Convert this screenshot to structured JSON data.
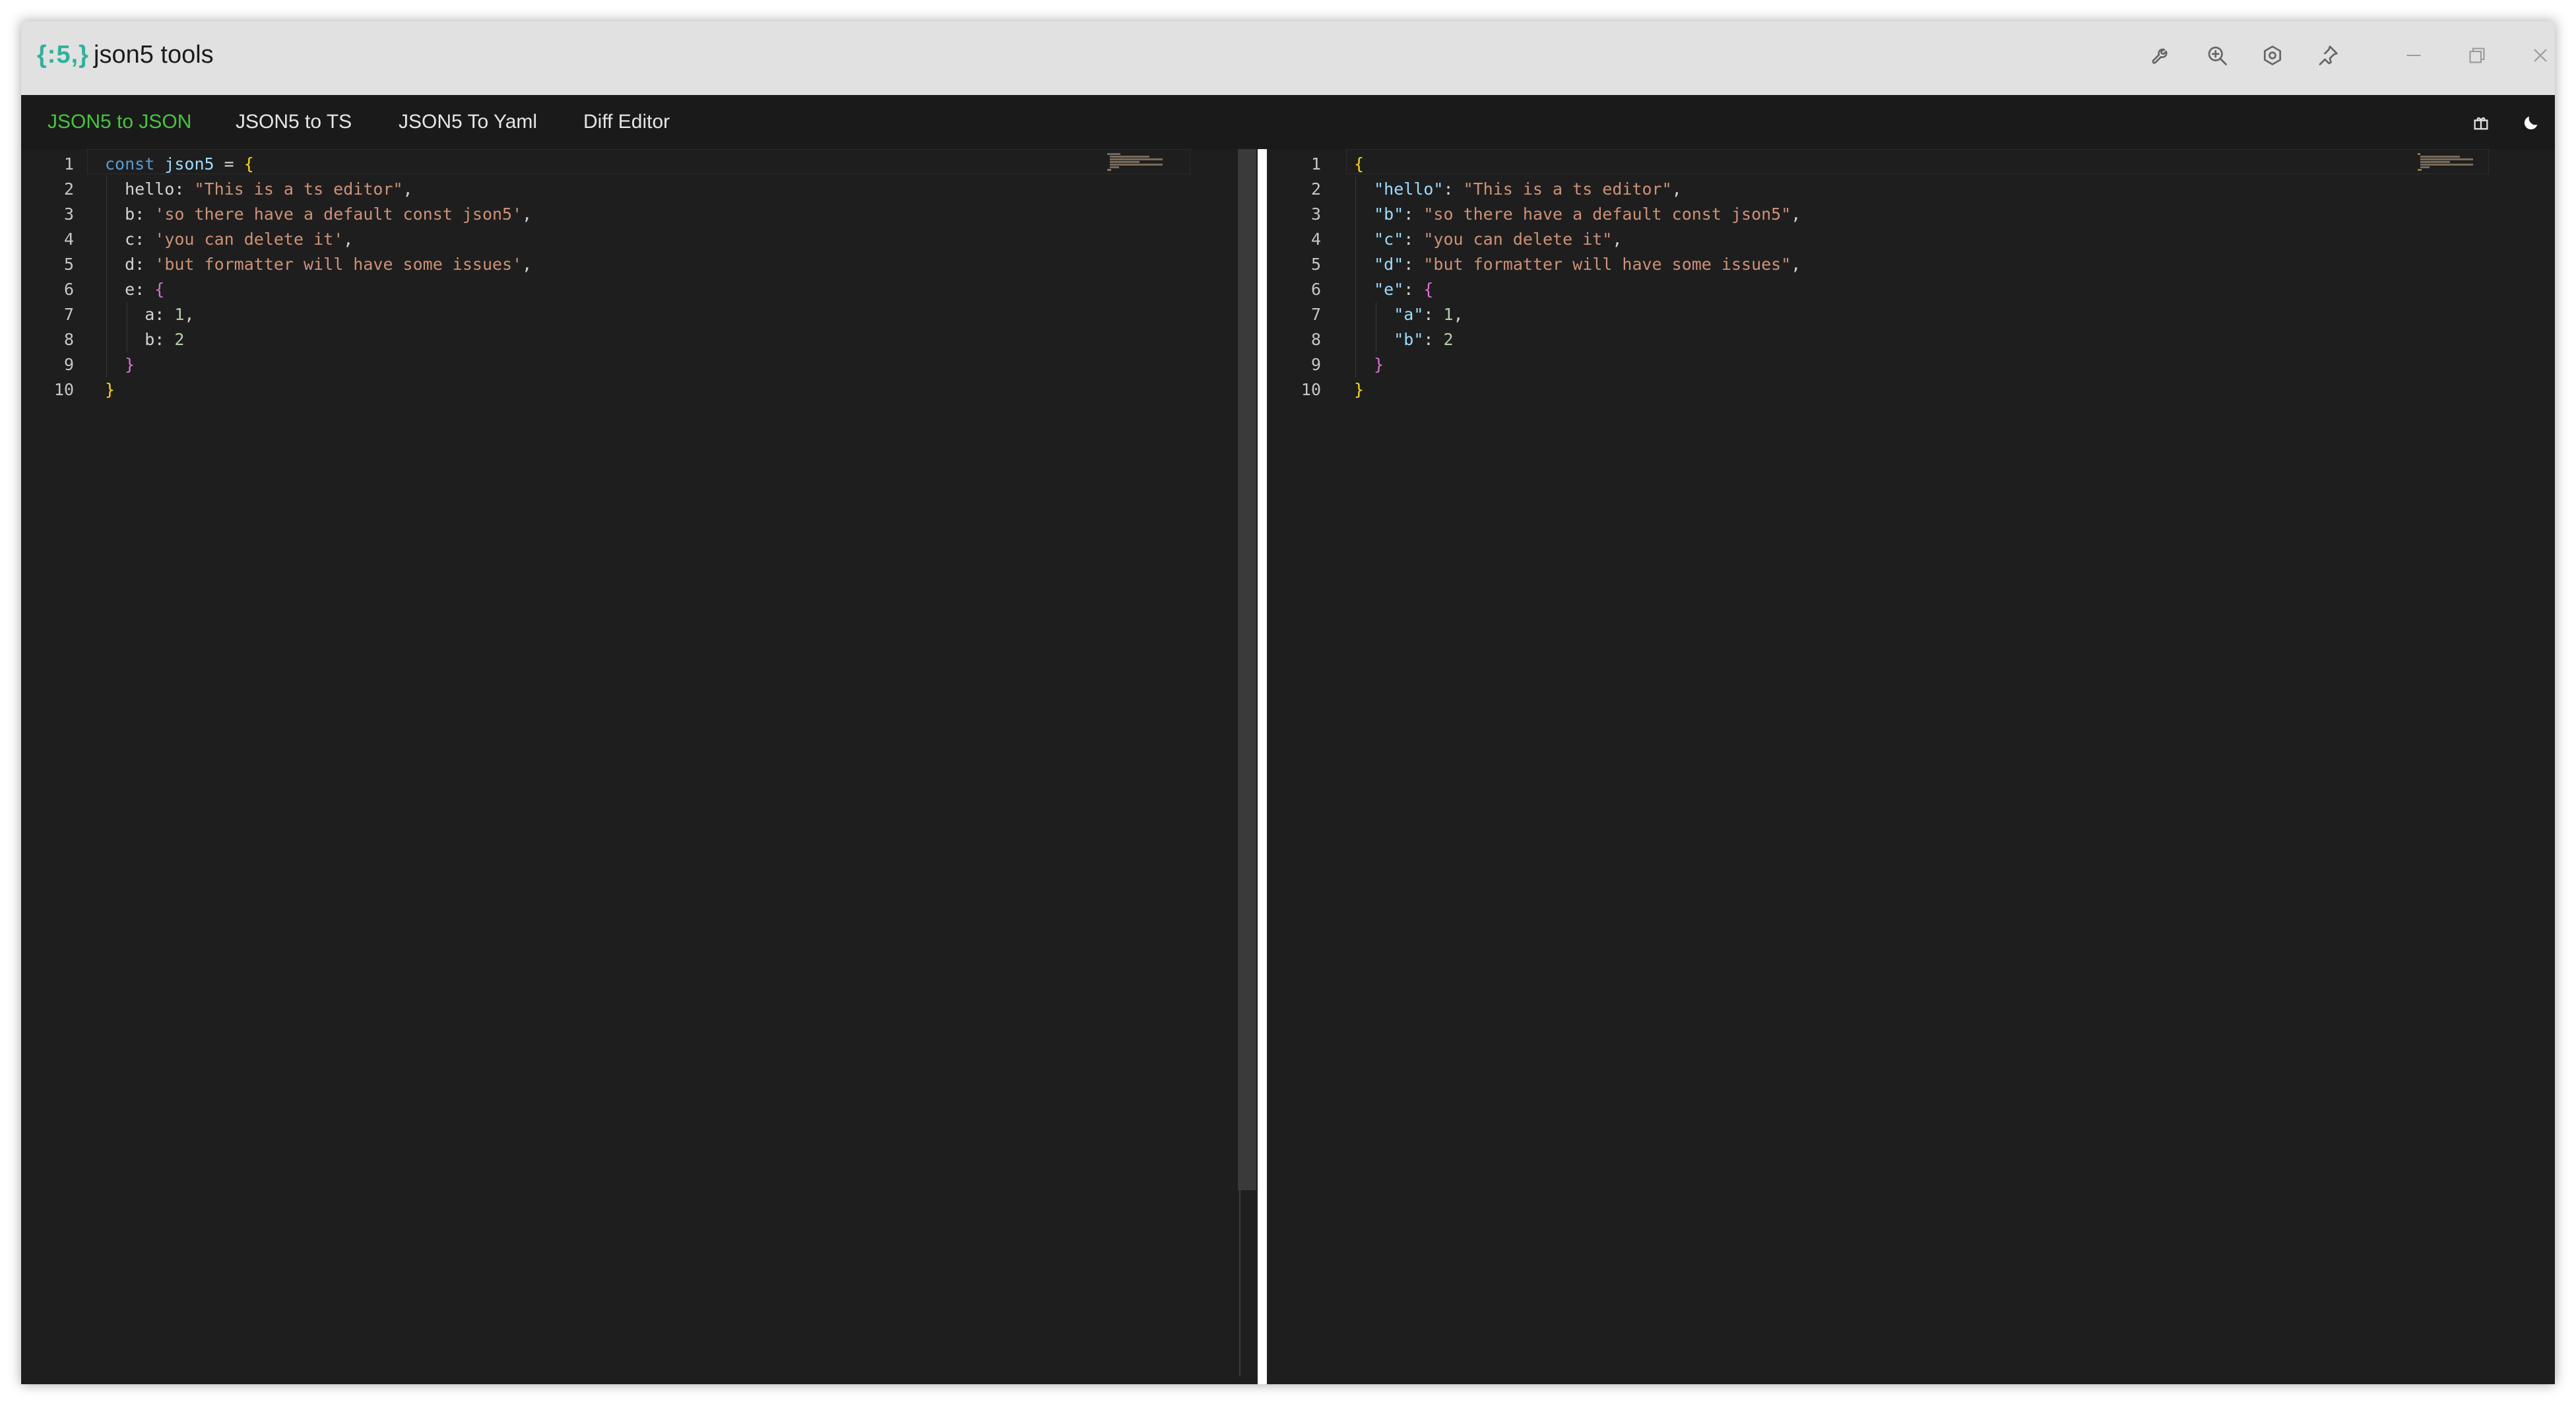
{
  "window": {
    "logo_text": "{:5,}",
    "title": "json5 tools",
    "toolbar_icons": [
      "wrench-icon",
      "zoom-in-icon",
      "settings-icon",
      "pin-icon",
      "minimize-icon",
      "restore-icon",
      "close-icon"
    ]
  },
  "tabs": [
    {
      "label": "JSON5 to JSON",
      "active": true
    },
    {
      "label": "JSON5 to TS",
      "active": false
    },
    {
      "label": "JSON5 To Yaml",
      "active": false
    },
    {
      "label": "Diff Editor",
      "active": false
    }
  ],
  "tabs_right_icons": [
    "gift-icon",
    "moon-icon"
  ],
  "colors": {
    "accent_active_tab": "#46c53d",
    "logo": "#2fb29d",
    "editor_bg": "#1e1e1e",
    "keyword": "#569cd6",
    "string": "#ce9178",
    "number": "#b5cea8",
    "bracket_level1": "#ffd700",
    "bracket_level2": "#da70d6"
  },
  "left_editor": {
    "line_numbers": [
      "1",
      "2",
      "3",
      "4",
      "5",
      "6",
      "7",
      "8",
      "9",
      "10"
    ],
    "lines": [
      [
        {
          "t": "const",
          "c": "kw"
        },
        {
          "t": " ",
          "c": "plain"
        },
        {
          "t": "json5",
          "c": "var"
        },
        {
          "t": " = ",
          "c": "plain"
        },
        {
          "t": "{",
          "c": "b1"
        }
      ],
      [
        {
          "t": "  hello: ",
          "c": "plain"
        },
        {
          "t": "\"This is a ts editor\"",
          "c": "str"
        },
        {
          "t": ",",
          "c": "plain"
        }
      ],
      [
        {
          "t": "  b: ",
          "c": "plain"
        },
        {
          "t": "'so there have a default const json5'",
          "c": "str"
        },
        {
          "t": ",",
          "c": "plain"
        }
      ],
      [
        {
          "t": "  c: ",
          "c": "plain"
        },
        {
          "t": "'you can delete it'",
          "c": "str"
        },
        {
          "t": ",",
          "c": "plain"
        }
      ],
      [
        {
          "t": "  d: ",
          "c": "plain"
        },
        {
          "t": "'but formatter will have some issues'",
          "c": "str"
        },
        {
          "t": ",",
          "c": "plain"
        }
      ],
      [
        {
          "t": "  e: ",
          "c": "plain"
        },
        {
          "t": "{",
          "c": "b2"
        }
      ],
      [
        {
          "t": "    a: ",
          "c": "plain"
        },
        {
          "t": "1",
          "c": "num"
        },
        {
          "t": ",",
          "c": "plain"
        }
      ],
      [
        {
          "t": "    b: ",
          "c": "plain"
        },
        {
          "t": "2",
          "c": "num"
        }
      ],
      [
        {
          "t": "  ",
          "c": "plain"
        },
        {
          "t": "}",
          "c": "b2"
        }
      ],
      [
        {
          "t": "}",
          "c": "b1"
        }
      ]
    ]
  },
  "right_editor": {
    "line_numbers": [
      "1",
      "2",
      "3",
      "4",
      "5",
      "6",
      "7",
      "8",
      "9",
      "10"
    ],
    "lines": [
      [
        {
          "t": "{",
          "c": "b1"
        }
      ],
      [
        {
          "t": "  ",
          "c": "plain"
        },
        {
          "t": "\"hello\"",
          "c": "prop"
        },
        {
          "t": ": ",
          "c": "plain"
        },
        {
          "t": "\"This is a ts editor\"",
          "c": "str"
        },
        {
          "t": ",",
          "c": "plain"
        }
      ],
      [
        {
          "t": "  ",
          "c": "plain"
        },
        {
          "t": "\"b\"",
          "c": "prop"
        },
        {
          "t": ": ",
          "c": "plain"
        },
        {
          "t": "\"so there have a default const json5\"",
          "c": "str"
        },
        {
          "t": ",",
          "c": "plain"
        }
      ],
      [
        {
          "t": "  ",
          "c": "plain"
        },
        {
          "t": "\"c\"",
          "c": "prop"
        },
        {
          "t": ": ",
          "c": "plain"
        },
        {
          "t": "\"you can delete it\"",
          "c": "str"
        },
        {
          "t": ",",
          "c": "plain"
        }
      ],
      [
        {
          "t": "  ",
          "c": "plain"
        },
        {
          "t": "\"d\"",
          "c": "prop"
        },
        {
          "t": ": ",
          "c": "plain"
        },
        {
          "t": "\"but formatter will have some issues\"",
          "c": "str"
        },
        {
          "t": ",",
          "c": "plain"
        }
      ],
      [
        {
          "t": "  ",
          "c": "plain"
        },
        {
          "t": "\"e\"",
          "c": "prop"
        },
        {
          "t": ": ",
          "c": "plain"
        },
        {
          "t": "{",
          "c": "b2"
        }
      ],
      [
        {
          "t": "    ",
          "c": "plain"
        },
        {
          "t": "\"a\"",
          "c": "prop"
        },
        {
          "t": ": ",
          "c": "plain"
        },
        {
          "t": "1",
          "c": "num"
        },
        {
          "t": ",",
          "c": "plain"
        }
      ],
      [
        {
          "t": "    ",
          "c": "plain"
        },
        {
          "t": "\"b\"",
          "c": "prop"
        },
        {
          "t": ": ",
          "c": "plain"
        },
        {
          "t": "2",
          "c": "num"
        }
      ],
      [
        {
          "t": "  ",
          "c": "plain"
        },
        {
          "t": "}",
          "c": "b2"
        }
      ],
      [
        {
          "t": "}",
          "c": "b1"
        }
      ]
    ]
  }
}
